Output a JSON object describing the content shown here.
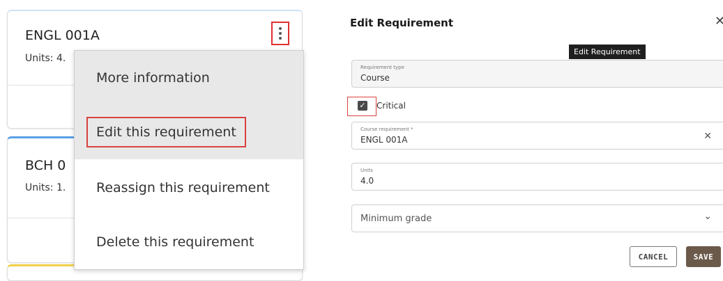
{
  "left": {
    "cards": [
      {
        "code": "ENGL 001A",
        "units": "Units: 4."
      },
      {
        "code": "BCH 0",
        "units": "Units: 1."
      }
    ],
    "menu": {
      "items": [
        {
          "label": "More information"
        },
        {
          "label": "Edit this requirement"
        },
        {
          "label": "Reassign this requirement"
        },
        {
          "label": "Delete this requirement"
        }
      ]
    }
  },
  "modal": {
    "title": "Edit Requirement",
    "close_symbol": "✕",
    "tooltip": "Edit Requirement",
    "requirement_type": {
      "label": "Requirement type",
      "value": "Course"
    },
    "critical": {
      "label": "Critical",
      "checked": true
    },
    "course_requirement": {
      "label": "Course requirement *",
      "value": "ENGL 001A",
      "clear_symbol": "✕"
    },
    "units": {
      "label": "Units",
      "value": "4.0"
    },
    "minimum_grade": {
      "placeholder": "Minimum grade",
      "chevron": "⌄"
    },
    "buttons": {
      "cancel": "CANCEL",
      "save": "SAVE"
    }
  },
  "colors": {
    "highlight_red": "#d9423f",
    "save_brown": "#6b5a4a",
    "card_blue": "#5aa0e6",
    "card_yellow": "#f2d14a"
  },
  "icons": [
    "kebab-icon",
    "close-icon",
    "check-icon",
    "clear-icon",
    "chevron-down-icon"
  ]
}
